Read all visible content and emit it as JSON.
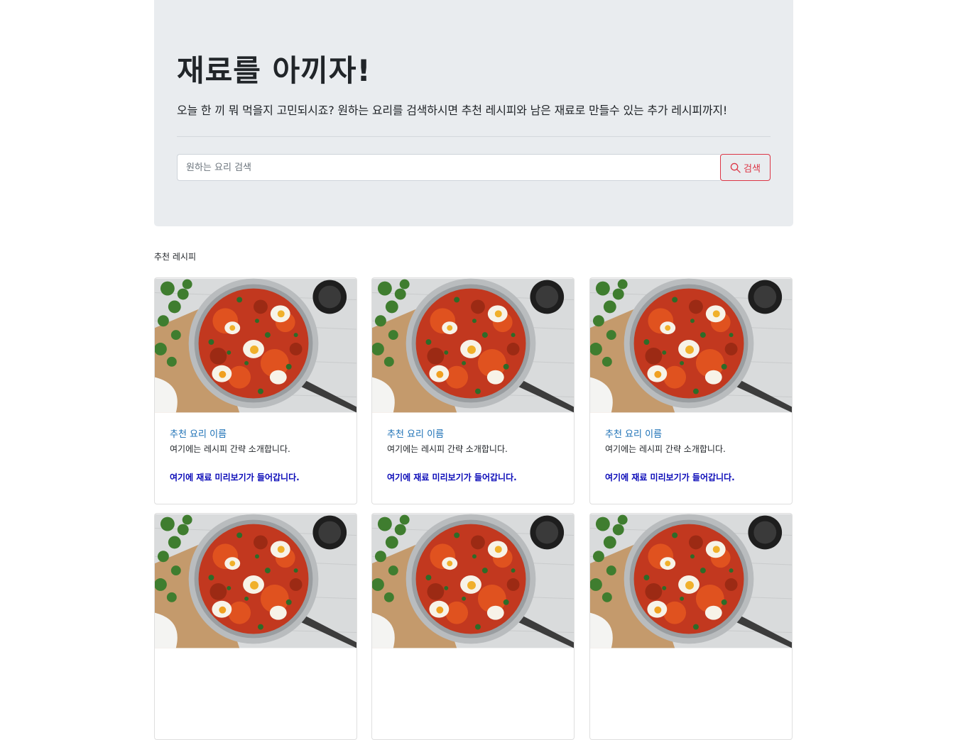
{
  "hero": {
    "title": "재료를 아끼자!",
    "lead": "오늘 한 끼 뭐 먹을지 고민되시죠? 원하는 요리를 검색하시면 추천 레시피와 남은 재료로 만들수 있는 추가 레시피까지!",
    "search_placeholder": "원하는 요리 검색",
    "search_button_label": "검색",
    "search_icon": "search-icon"
  },
  "recommend": {
    "section_title": "추천 레시피",
    "cards": [
      {
        "image": "shakshuka-pan-image",
        "title": "추천 요리 이름",
        "description": "여기에는 레시피 간략 소개합니다.",
        "ingredients_preview": "여기에 재료 미리보기가 들어갑니다."
      },
      {
        "image": "shakshuka-pan-image",
        "title": "추천 요리 이름",
        "description": "여기에는 레시피 간략 소개합니다.",
        "ingredients_preview": "여기에 재료 미리보기가 들어갑니다."
      },
      {
        "image": "shakshuka-pan-image",
        "title": "추천 요리 이름",
        "description": "여기에는 레시피 간략 소개합니다.",
        "ingredients_preview": "여기에 재료 미리보기가 들어갑니다."
      },
      {
        "image": "shakshuka-pan-image"
      },
      {
        "image": "shakshuka-pan-image"
      },
      {
        "image": "shakshuka-pan-image"
      }
    ]
  },
  "colors": {
    "hero_background": "#e9ecef",
    "search_button": "#dc3545",
    "card_title": "#1a6fb5",
    "ingredients_text": "#0a0ab8"
  }
}
